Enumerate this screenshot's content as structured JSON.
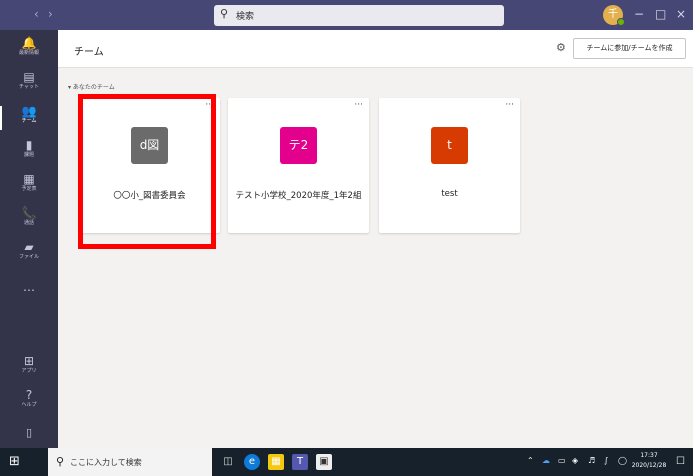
{
  "titlebar": {
    "back_icon": "chevron-left-icon",
    "forward_icon": "chevron-right-icon",
    "search_placeholder": "検索",
    "avatar_initial": "千",
    "minimize": "−",
    "maximize": "□",
    "close": "×",
    "bg_color": "#464775"
  },
  "rail": {
    "items": [
      {
        "icon": "bell-icon",
        "glyph": "🔔",
        "label": "最新情報"
      },
      {
        "icon": "chat-icon",
        "glyph": "▤",
        "label": "チャット"
      },
      {
        "icon": "teams-icon",
        "glyph": "👥",
        "label": "チーム"
      },
      {
        "icon": "assignments-icon",
        "glyph": "▮",
        "label": "課題"
      },
      {
        "icon": "calendar-icon",
        "glyph": "▦",
        "label": "予定表"
      },
      {
        "icon": "phone-icon",
        "glyph": "📞",
        "label": "通話"
      },
      {
        "icon": "files-icon",
        "glyph": "▰",
        "label": "ファイル"
      },
      {
        "icon": "more-icon",
        "glyph": "…",
        "label": ""
      },
      {
        "icon": "apps-icon",
        "glyph": "⊞",
        "label": "アプリ"
      },
      {
        "icon": "help-icon",
        "glyph": "?",
        "label": "ヘルプ"
      }
    ],
    "bottom_icon": "device-icon",
    "bg_color": "#33344a"
  },
  "header": {
    "title": "チーム",
    "join_button": "チームに参加/チームを作成"
  },
  "section_label": "▾ あなたのチーム",
  "teams": [
    {
      "initials": "d図",
      "name": "〇〇小_図書委員会",
      "color": "#6b6b6b"
    },
    {
      "initials": "テ2",
      "name": "テスト小学校_2020年度_1年2組",
      "color": "#e3008c"
    },
    {
      "initials": "t",
      "name": "test",
      "color": "#d83b01"
    }
  ],
  "card_more": "···",
  "taskbar": {
    "search_placeholder": "ここに入力して検索",
    "time": "17:37",
    "date": "2020/12/28",
    "bg_color": "#17212b"
  }
}
